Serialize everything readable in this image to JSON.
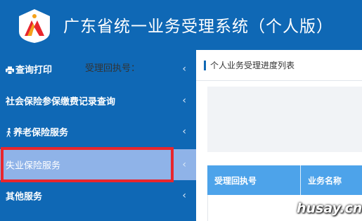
{
  "app": {
    "title": "广东省统一业务受理系统（个人版）"
  },
  "sidebar": {
    "items": [
      {
        "label": "查询打印",
        "icon": "printer-icon"
      },
      {
        "label": "社会保险参保缴费记录查询"
      },
      {
        "label": "养老保险服务",
        "icon": "walking-person-icon"
      },
      {
        "label": "失业保险服务",
        "active": true
      },
      {
        "label": "其他服务"
      }
    ],
    "chevron": "‹"
  },
  "content": {
    "title": "个人业务受理进度列表",
    "search_label": "受理回执号：",
    "table": {
      "columns": [
        "受理回执号",
        "业务名称"
      ]
    }
  },
  "colors": {
    "brand": "#0f68b5",
    "active": "#8fb3e8",
    "highlight": "#e8262d",
    "table_header": "#4da3ea"
  },
  "watermark": "husay.cn"
}
